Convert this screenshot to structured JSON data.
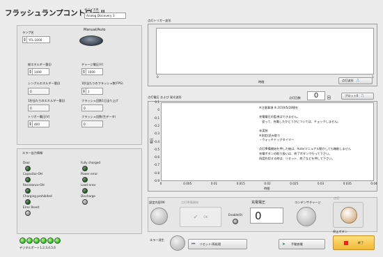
{
  "header": {
    "title": "フラッシュランプコントロール",
    "device_label": "デバイス名",
    "device_value": "Analog Discovery 3"
  },
  "settings": {
    "lamp_label": "ランプ名",
    "lamp_value": "YFL-1000",
    "manual_auto_label": "Manual/Auto",
    "input_energy_label": "総エネルギー量(J)",
    "input_energy_value": "1400",
    "charge_voltage_label": "チャージ電圧(V)",
    "charge_voltage_value": "1000",
    "single_energy_label": "シングルエネルギー量(J)",
    "single_energy_value": "0",
    "flash_per_sec_label": "1秒当たりのフラッシュ数(FPS)",
    "flash_per_sec_value": "1",
    "energy_per_sec_label": "1秒当たりのエネルギー量(J)",
    "energy_per_sec_value": "0",
    "flash_count_label": "フラッシュ回数1日当り上げ",
    "flash_count_value": "0",
    "trigger_voltage_label": "トリガー電圧(V)",
    "trigger_voltage_value": "400",
    "flash_total_label": "フラッシュ回数(生データ)",
    "flash_total_value": "0"
  },
  "errors": {
    "title": "エラー出力情報",
    "left": [
      "Door",
      "Capacitor-OH",
      "Resistance-OH",
      "Charging prohibited",
      "Error Reset"
    ],
    "right": [
      "Fully charged",
      "Power error",
      "Load error",
      "Discharge"
    ]
  },
  "digital": {
    "label": "デジタルポート1,2,3,4,5,6",
    "count": 6
  },
  "trigger_graph": {
    "title": "点灯トリガー波形",
    "xaxis": "時間",
    "x_start": "0",
    "x_end": "1",
    "button_label": "点灯波形"
  },
  "voltage_graph": {
    "title": "点灯電圧 および 発光波形",
    "count_label": "点灯回数",
    "count_value": "0",
    "count_unit": "回",
    "plot_button": "プロット0",
    "ylabel": "電圧",
    "xlabel": "時間",
    "yticks": [
      "0.1",
      "0",
      "-0.1",
      "-0.2",
      "-0.3",
      "-0.4",
      "-0.5",
      "-0.6",
      "-0.7",
      "-0.8",
      "-0.9"
    ],
    "xticks": [
      "0",
      "0.005",
      "0.01",
      "0.015",
      "0.02",
      "0.025",
      "0.03",
      "0.035",
      "0.04"
    ],
    "notes": [
      "※注意事項 ※ 2019/5/28現在",
      "",
      "充電電圧の監視はできません。",
      "　従って、充電したかどうかについては、チェックしません。",
      "",
      "未実装",
      "※測定(読み取り",
      "・ウォッチドッグタイマー",
      "",
      "点灯準備開始を押した後は、Auto/マニュアル動かしても機能しません",
      "充電ボタンの取り扱いは、終了ボタンで行って下さい。",
      "再度利用する時は、リセット、終了などを押して下さい。"
    ]
  },
  "controls": {
    "settings_ok": "設定内容OK",
    "prep_label": "点灯準備開始",
    "ok_label": "OK",
    "enable_label": "Enable(0)",
    "charge_voltage_label": "充電電圧",
    "charge_voltage_value": "0",
    "condenser_label": "コンデンサチャージ",
    "fire_label": "点灯",
    "error_label": "エラー発生",
    "reset_label": "リセット/再処理",
    "discharge_label": "手動放電",
    "stop_label": "停止ボタン",
    "end_label": "終了"
  }
}
